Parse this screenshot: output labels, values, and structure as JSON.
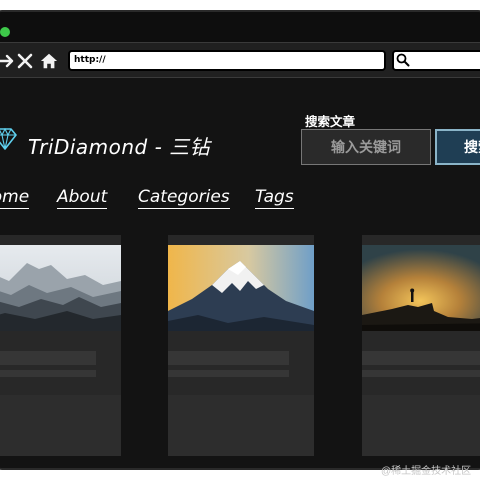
{
  "browser": {
    "url": "http://",
    "icons": [
      "forward-icon",
      "close-icon",
      "home-icon",
      "search-icon"
    ]
  },
  "header": {
    "logo_icon": "diamond-icon",
    "site_title": "TriDiamond - 三钻",
    "search_label": "搜索文章",
    "search_placeholder": "输入关键词",
    "search_button": "搜索"
  },
  "nav": {
    "items": [
      {
        "label": "Home"
      },
      {
        "label": "About"
      },
      {
        "label": "Categories"
      },
      {
        "label": "Tags"
      }
    ]
  },
  "posts": [
    {
      "image": "misty-mountain-range"
    },
    {
      "image": "snowy-mountain-peak"
    },
    {
      "image": "hiker-on-rock-at-sunset"
    }
  ],
  "watermark": "@稀土掘金技术社区",
  "colors": {
    "page_background": "#131313",
    "card_background": "#282828",
    "search_button": "#1f3e54",
    "text": "#ffffff"
  }
}
